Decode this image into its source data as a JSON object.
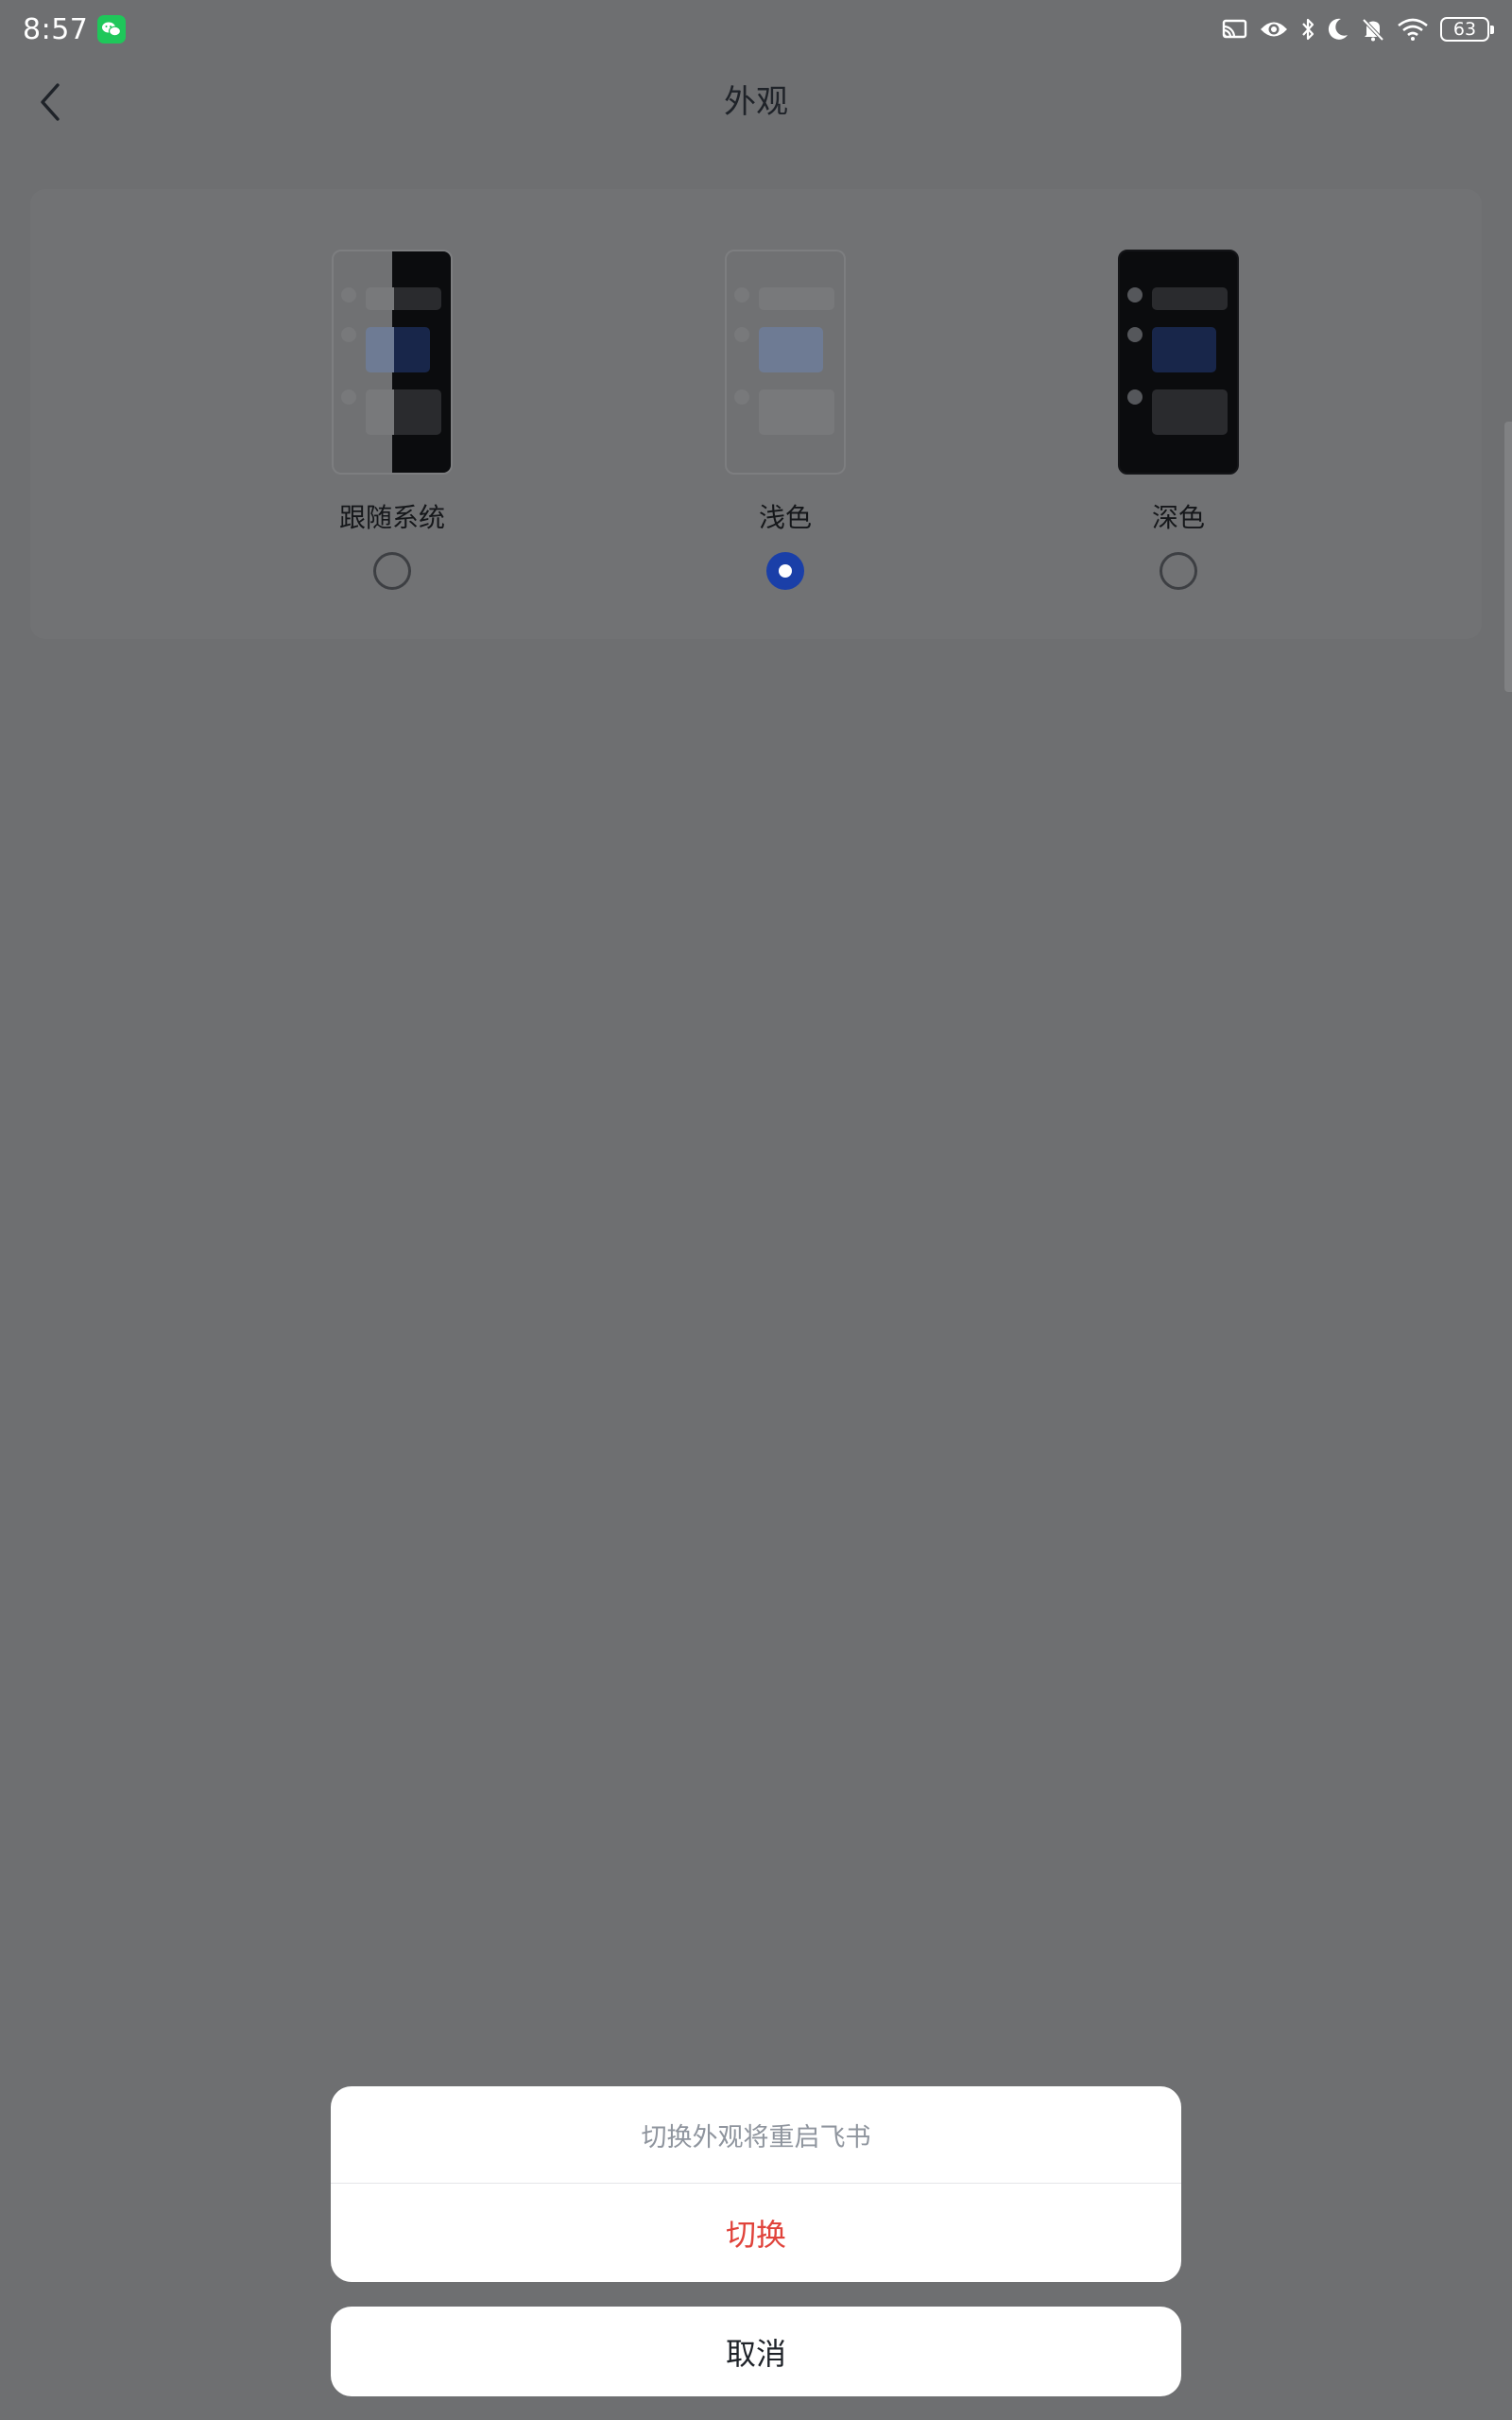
{
  "status_bar": {
    "time": "8:57",
    "battery_level": "63",
    "icons": [
      "wechat-icon",
      "cast-icon",
      "eye-icon",
      "bluetooth-icon",
      "moon-icon",
      "bell-off-icon",
      "wifi-icon",
      "battery-icon"
    ]
  },
  "header": {
    "title": "外观",
    "back_icon": "chevron-left-icon"
  },
  "appearance_options": [
    {
      "label": "跟随系统",
      "selected": false,
      "preview": "split"
    },
    {
      "label": "浅色",
      "selected": true,
      "preview": "light"
    },
    {
      "label": "深色",
      "selected": false,
      "preview": "dark"
    }
  ],
  "dialog": {
    "message": "切换外观将重启飞书",
    "confirm_label": "切换",
    "cancel_label": "取消"
  },
  "colors": {
    "overlay_bg": "#6e6f71",
    "selected_radio": "#1a3fa8",
    "confirm_text": "#e0433b",
    "wechat_green": "#1fc75a"
  }
}
